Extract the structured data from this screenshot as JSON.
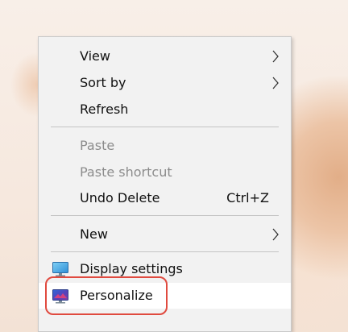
{
  "context_menu": {
    "items": [
      {
        "id": "view",
        "label": "View",
        "submenu": true,
        "disabled": false
      },
      {
        "id": "sort-by",
        "label": "Sort by",
        "submenu": true,
        "disabled": false
      },
      {
        "id": "refresh",
        "label": "Refresh",
        "submenu": false,
        "disabled": false
      },
      {
        "id": "paste",
        "label": "Paste",
        "submenu": false,
        "disabled": true
      },
      {
        "id": "paste-shortcut",
        "label": "Paste shortcut",
        "submenu": false,
        "disabled": true
      },
      {
        "id": "undo-delete",
        "label": "Undo Delete",
        "shortcut": "Ctrl+Z",
        "submenu": false,
        "disabled": false
      },
      {
        "id": "new",
        "label": "New",
        "submenu": true,
        "disabled": false
      },
      {
        "id": "display-settings",
        "label": "Display settings",
        "icon": "display-settings-icon",
        "disabled": false
      },
      {
        "id": "personalize",
        "label": "Personalize",
        "icon": "personalize-icon",
        "disabled": false,
        "highlighted": true
      }
    ]
  },
  "colors": {
    "menu_background": "#f2f2f2",
    "hover_background": "#ffffff",
    "disabled_text": "#8c8c8c",
    "annotation_ring": "#e04a3f"
  }
}
